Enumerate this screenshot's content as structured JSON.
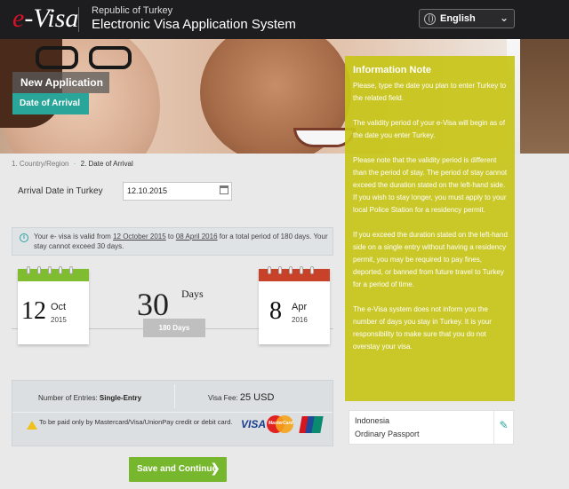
{
  "header": {
    "logo_e": "e",
    "logo_rest": "-Visa",
    "subtitle": "Republic of Turkey",
    "title": "Electronic Visa Application System",
    "language": "English"
  },
  "banner": {
    "label_primary": "New Application",
    "label_secondary": "Date of Arrival"
  },
  "breadcrumb": {
    "step1": "1. Country/Region",
    "separator": "·",
    "step2": "2. Date of Arrival"
  },
  "arrival": {
    "label": "Arrival Date in Turkey",
    "value": "12.10.2015"
  },
  "notice": {
    "text_prefix": "Your e- visa is valid from ",
    "from_date": "12 October 2015",
    "to_word": " to ",
    "to_date": "08 April 2016",
    "text_suffix": " for a total period of 180 days. Your stay cannot exceed 30 days."
  },
  "calendar_start": {
    "day": "12",
    "month": "Oct",
    "year": "2015"
  },
  "calendar_end": {
    "day": "8",
    "month": "Apr",
    "year": "2016"
  },
  "stay": {
    "number": "30",
    "word": "Days",
    "validity": "180 Days"
  },
  "panel": {
    "entries_label": "Number of Entries: ",
    "entries_value": "Single-Entry",
    "fee_label": "Visa Fee: ",
    "fee_value": "25 USD",
    "payment_text": "To be paid only by Mastercard/Visa/UnionPay credit or debit card.",
    "visa_logo": "VISA",
    "mastercard_logo": "MasterCard"
  },
  "save_button": {
    "label": "Save and Continue",
    "arrow": "❯"
  },
  "info_note": {
    "title": "Information Note",
    "paragraphs": [
      "Please, type the date you plan to enter Turkey to the related field.",
      "The validity period of your e-Visa will begin as of the date you enter Turkey.",
      "Please note that the validity period is different than the period of stay. The period of stay cannot exceed the duration stated on the left-hand side. If you wish to stay longer, you must apply to your local Police Station for a residency permit.",
      "If you exceed the duration stated on the left-hand side on a single entry without having a residency permit, you may be required to pay fines, deported, or banned from future travel to Turkey for a period of time.",
      "The e-Visa system does not inform you the number of days you stay in Turkey. It is your responsibility to make sure that you do not overstay your visa."
    ]
  },
  "applicant": {
    "country": "Indonesia",
    "document": "Ordinary Passport"
  },
  "colors": {
    "accent_teal": "#29a59a",
    "accent_green": "#76b72e",
    "info_yellow": "#c7c519",
    "calendar_end_red": "#c8422a"
  },
  "icons": [
    "globe-icon",
    "chevron-down-icon",
    "calendar-icon",
    "info-icon",
    "warning-icon",
    "pencil-icon",
    "arrow-right-icon"
  ]
}
